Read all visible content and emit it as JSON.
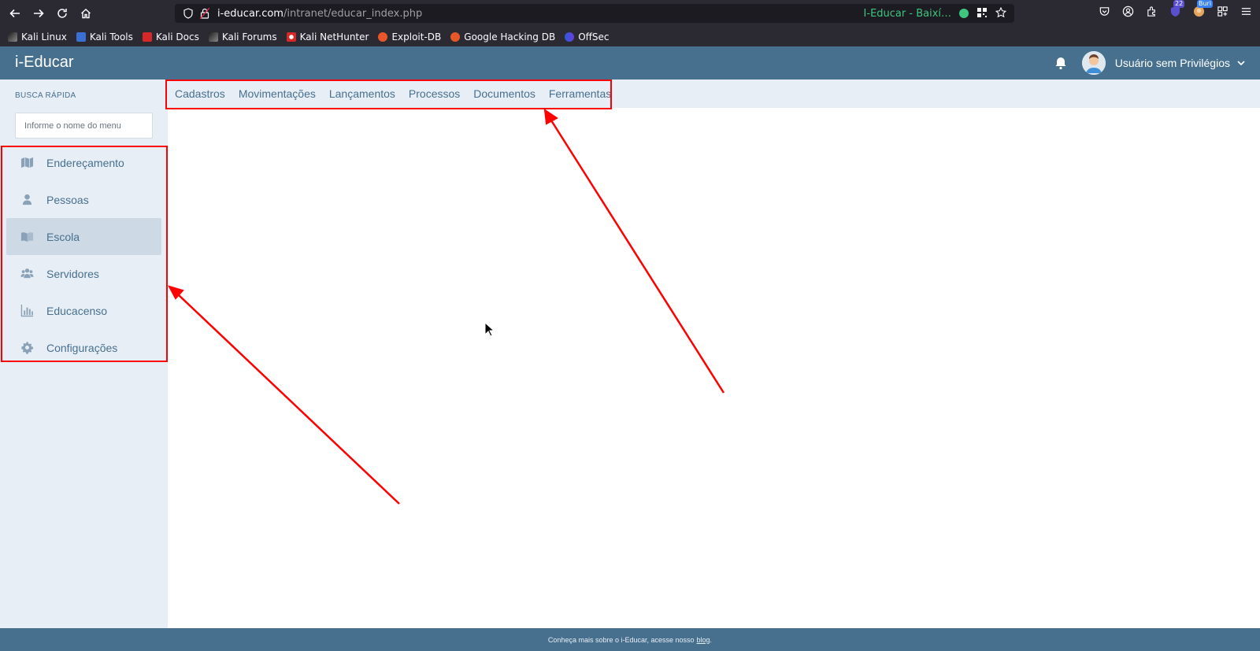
{
  "browser": {
    "url_host": "i-educar.com",
    "url_path": "/intranet/educar_index.php",
    "site_name": "I-Educar - Baixí…",
    "badges": {
      "ext1": "22",
      "ext2": "Buri"
    },
    "bookmarks": [
      {
        "label": "Kali Linux",
        "icon": "kali-dragon-icon"
      },
      {
        "label": "Kali Tools",
        "icon": "kali-tools-icon"
      },
      {
        "label": "Kali Docs",
        "icon": "kali-docs-icon"
      },
      {
        "label": "Kali Forums",
        "icon": "kali-dragon-icon"
      },
      {
        "label": "Kali NetHunter",
        "icon": "nethunter-icon"
      },
      {
        "label": "Exploit-DB",
        "icon": "exploitdb-icon"
      },
      {
        "label": "Google Hacking DB",
        "icon": "exploitdb-icon"
      },
      {
        "label": "OffSec",
        "icon": "offsec-icon"
      }
    ]
  },
  "header": {
    "app_title": "i-Educar",
    "user_name": "Usuário sem Privilégios"
  },
  "sidebar": {
    "quick_search_label": "BUSCA RÁPIDA",
    "quick_search_placeholder": "Informe o nome do menu",
    "items": [
      {
        "label": "Endereçamento",
        "icon": "map-icon",
        "active": false
      },
      {
        "label": "Pessoas",
        "icon": "user-icon",
        "active": false
      },
      {
        "label": "Escola",
        "icon": "book-open-icon",
        "active": true
      },
      {
        "label": "Servidores",
        "icon": "users-icon",
        "active": false
      },
      {
        "label": "Educacenso",
        "icon": "bar-chart-icon",
        "active": false
      },
      {
        "label": "Configurações",
        "icon": "gear-icon",
        "active": false
      }
    ]
  },
  "topmenu": {
    "items": [
      "Cadastros",
      "Movimentações",
      "Lançamentos",
      "Processos",
      "Documentos",
      "Ferramentas"
    ]
  },
  "footer": {
    "text": "Conheça mais sobre o i-Educar, acesse nosso",
    "link": "blog",
    "suffix": "."
  },
  "colors": {
    "header_bg": "#47708f",
    "sidebar_bg": "#e8eef5",
    "active_item_bg": "#cdd9e4",
    "annotation": "#ff0000"
  }
}
